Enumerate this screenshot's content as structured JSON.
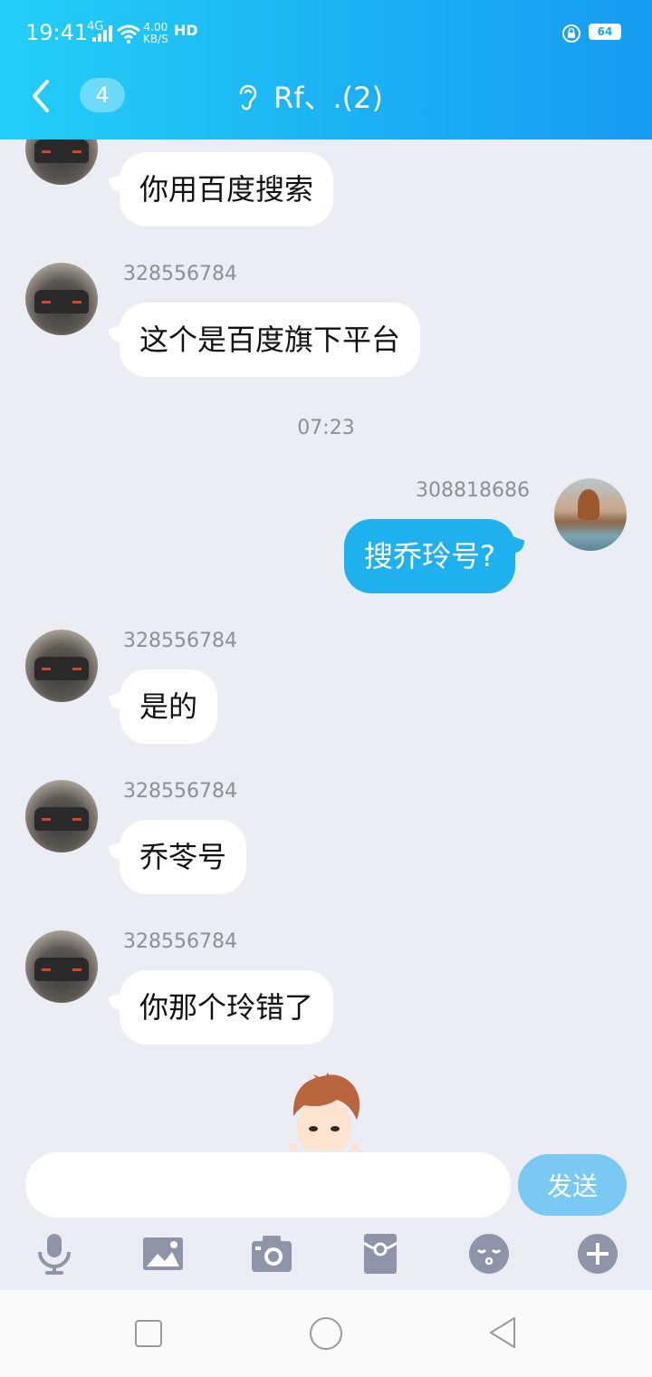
{
  "status_bar": {
    "time": "19:41",
    "network": "4G",
    "speed_value": "4.00",
    "speed_unit": "KB/S",
    "hd": "HD",
    "battery": "64"
  },
  "header": {
    "unread_count": "4",
    "title": "Rf、.(2)",
    "icons": {
      "back": "chevron-left",
      "mode": "ear"
    }
  },
  "messages": [
    {
      "id": "m1",
      "side": "in",
      "sender": "",
      "text": "你用百度搜索"
    },
    {
      "id": "m2",
      "side": "in",
      "sender": "328556784",
      "text": "这个是百度旗下平台"
    },
    {
      "id": "m3",
      "side": "out",
      "sender": "308818686",
      "text": "搜乔玲号?"
    },
    {
      "id": "m4",
      "side": "in",
      "sender": "328556784",
      "text": "是的"
    },
    {
      "id": "m5",
      "side": "in",
      "sender": "328556784",
      "text": "乔苓号"
    },
    {
      "id": "m6",
      "side": "in",
      "sender": "328556784",
      "text": "你那个玲错了"
    }
  ],
  "timestamp": "07:23",
  "input": {
    "value": "",
    "send_label": "发送"
  },
  "toolbar": [
    "microphone",
    "image",
    "camera",
    "red-packet",
    "emoji",
    "plus"
  ],
  "colors": {
    "header_start": "#22cff8",
    "header_end": "#169cf2",
    "outgoing_bubble": "#1fb0f0",
    "send_button": "#79c9f4",
    "chat_bg": "#eaedf4"
  }
}
